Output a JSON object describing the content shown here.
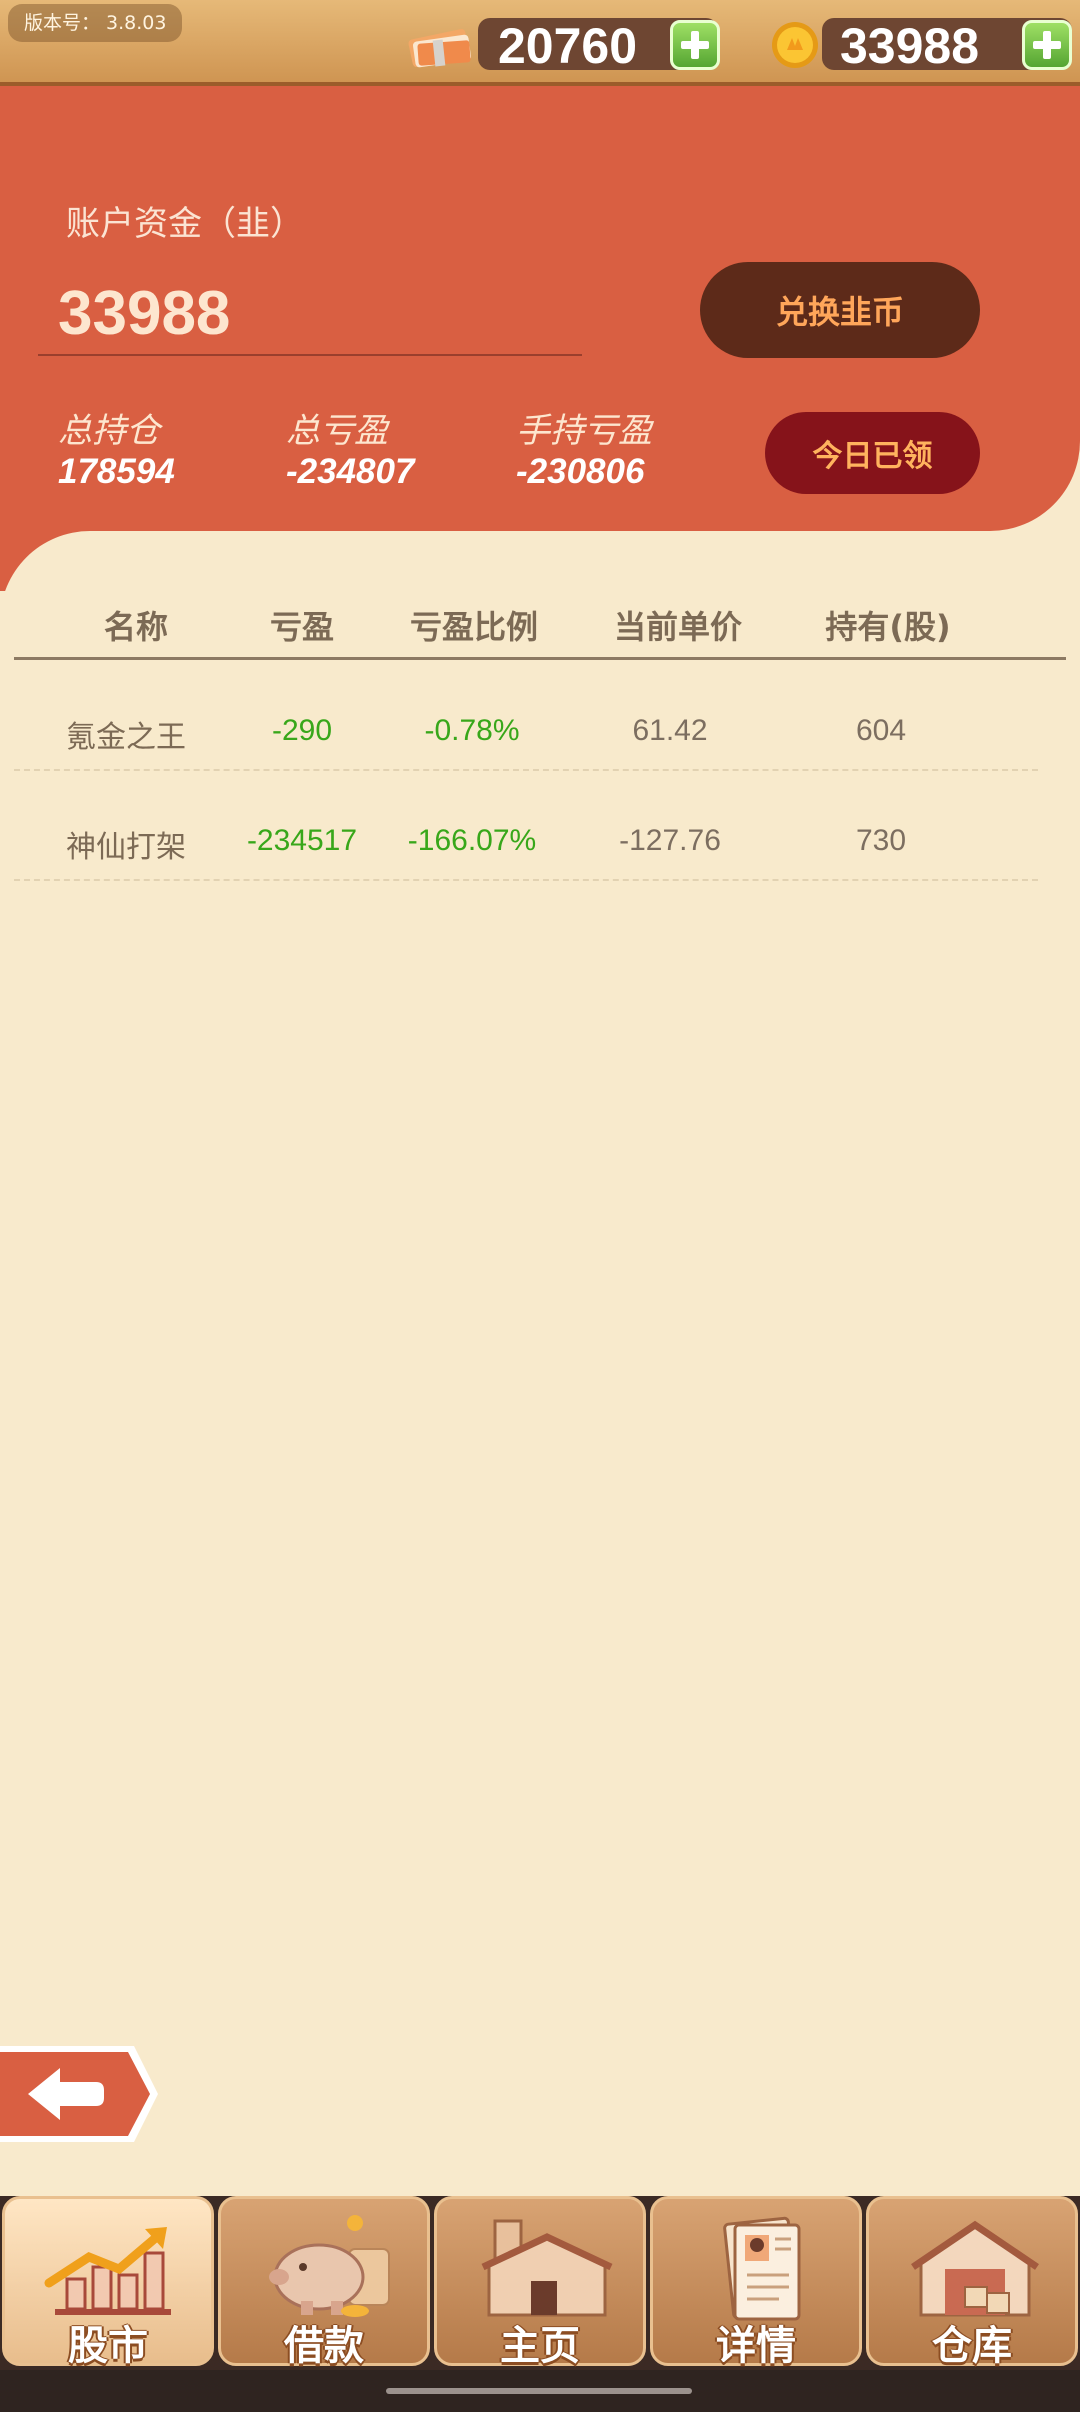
{
  "top_bar": {
    "version_label": "版本号： 3.8.03",
    "cash_value": "20760",
    "coin_value": "33988"
  },
  "account": {
    "title": "账户资金（韭）",
    "value": "33988",
    "exchange_button": "兑换韭币",
    "claimed_button": "今日已领",
    "stats": [
      {
        "label": "总持仓",
        "value": "178594"
      },
      {
        "label": "总亏盈",
        "value": "-234807"
      },
      {
        "label": "手持亏盈",
        "value": "-230806"
      }
    ]
  },
  "table": {
    "headers": [
      "名称",
      "亏盈",
      "亏盈比例",
      "当前单价",
      "持有(股)"
    ],
    "rows": [
      {
        "name": "氪金之王",
        "pnl": "-290",
        "pnl_ratio": "-0.78%",
        "price": "61.42",
        "shares": "604"
      },
      {
        "name": "神仙打架",
        "pnl": "-234517",
        "pnl_ratio": "-166.07%",
        "price": "-127.76",
        "shares": "730"
      }
    ]
  },
  "nav": {
    "items": [
      {
        "label": "股市",
        "icon": "stock-chart-icon",
        "active": true
      },
      {
        "label": "借款",
        "icon": "piggy-bank-icon",
        "active": false
      },
      {
        "label": "主页",
        "icon": "house-icon",
        "active": false
      },
      {
        "label": "详情",
        "icon": "profile-document-icon",
        "active": false
      },
      {
        "label": "仓库",
        "icon": "warehouse-icon",
        "active": false
      }
    ]
  },
  "colors": {
    "header": "#d95f42",
    "background": "#f8eacc",
    "positive_green": "#38a71a"
  }
}
